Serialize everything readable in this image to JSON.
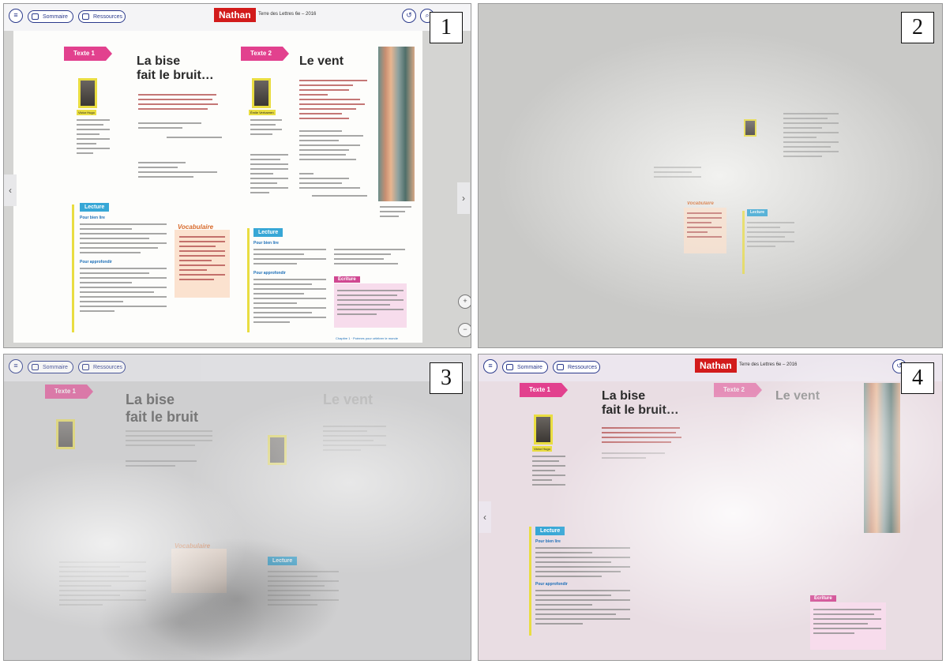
{
  "panels": [
    {
      "number": "1"
    },
    {
      "number": "2"
    },
    {
      "number": "3"
    },
    {
      "number": "4"
    }
  ],
  "toolbar": {
    "summary_label": "Sommaire",
    "resources_label": "Ressources",
    "brand": "Nathan",
    "book_title": "Terre des Lettres 6e – 2016"
  },
  "text1": {
    "tag": "Texte 1",
    "title_line1": "La bise",
    "title_line2": "fait le bruit…",
    "author": "Victor Hugo"
  },
  "text2": {
    "tag": "Texte 2",
    "title": "Le vent",
    "author": "Émile Verhaeren"
  },
  "sections": {
    "lecture": "Lecture",
    "pour_bien_lire": "Pour bien lire",
    "pour_approfondir": "Pour approfondir",
    "vocabulaire": "Vocabulaire",
    "ecriture": "Écriture",
    "footer": "Chapitre 1 · Poèmes pour célébrer le monde"
  },
  "icons": {
    "menu": "menu-icon",
    "undo": "undo-icon",
    "search": "search-icon",
    "prev": "chevron-left-icon",
    "next": "chevron-right-icon",
    "zoom_in": "zoom-in-icon",
    "zoom_out": "zoom-out-icon"
  },
  "colors": {
    "accent_blue": "#2b3a8c",
    "brand_red": "#d21b1b",
    "tag_pink": "#e2418e",
    "lecture_blue": "#37a7d6",
    "vocab_orange": "#d86a2b",
    "portrait_yellow": "#e9dd41"
  }
}
